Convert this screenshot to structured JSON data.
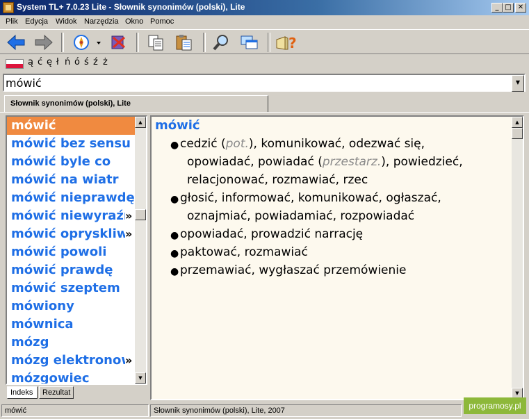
{
  "window": {
    "title": "System TL+ 7.0.23 Lite - Słownik synonimów (polski), Lite"
  },
  "menu": [
    "Plik",
    "Edycja",
    "Widok",
    "Narzędzia",
    "Okno",
    "Pomoc"
  ],
  "letters": [
    "ą",
    "ć",
    "ę",
    "ł",
    "ń",
    "ó",
    "ś",
    "ź",
    "ż"
  ],
  "search": {
    "value": "mówić"
  },
  "tab": {
    "label": "Słownik synonimów (polski), Lite"
  },
  "list": {
    "items": [
      "mówić",
      "mówić bez sensu",
      "mówić byle co",
      "mówić na wiatr",
      "mówić nieprawdę",
      "mówić niewyraźnie",
      "mówić opryskliwie",
      "mówić powoli",
      "mówić prawdę",
      "mówić szeptem",
      "mówiony",
      "mównica",
      "mózg",
      "mózg elektronowy",
      "mózgowiec"
    ],
    "selected_index": 0,
    "more_marker": "»"
  },
  "bottom_tabs": {
    "index": "Indeks",
    "results": "Rezultat"
  },
  "definition": {
    "headword": "mówić",
    "senses": {
      "s1_l1_a": "cedzić (",
      "s1_l1_q": "pot.",
      "s1_l1_b": "), komunikować, odezwać się,",
      "s1_l2_a": "opowiadać, powiadać (",
      "s1_l2_q": "przestarz.",
      "s1_l2_b": "), powiedzieć,",
      "s1_l3": "relacjonować, rozmawiać, rzec",
      "s2_l1": "głosić, informować, komunikować, ogłaszać,",
      "s2_l2": "oznajmiać, powiadamiać, rozpowiadać",
      "s3_l1": "opowiadać, prowadzić narrację",
      "s4_l1": "paktować, rozmawiać",
      "s5_l1": "przemawiać, wygłaszać przemówienie"
    },
    "bullet": "●"
  },
  "status": {
    "left": "mówić",
    "right": "Słownik synonimów (polski), Lite, 2007"
  },
  "watermark": "programosy.pl"
}
